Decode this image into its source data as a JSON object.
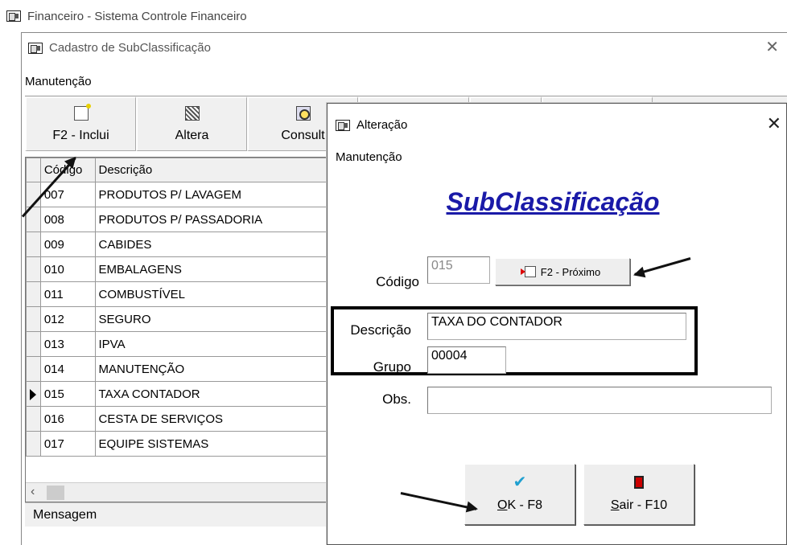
{
  "main_window": {
    "title": "Financeiro - Sistema Controle Financeiro"
  },
  "cadastro_window": {
    "title": "Cadastro de SubClassificação",
    "close_glyph": "✕",
    "menu": "Manutenção",
    "toolbar": {
      "inclui": "F2 - Inclui",
      "altera": "Altera",
      "consulta": "Consult"
    },
    "grid": {
      "headers": {
        "code": "Código",
        "desc": "Descrição"
      },
      "rows": [
        {
          "code": "007",
          "desc": "PRODUTOS P/ LAVAGEM"
        },
        {
          "code": "008",
          "desc": "PRODUTOS P/ PASSADORIA"
        },
        {
          "code": "009",
          "desc": "CABIDES"
        },
        {
          "code": "010",
          "desc": "EMBALAGENS"
        },
        {
          "code": "011",
          "desc": "COMBUSTÍVEL"
        },
        {
          "code": "012",
          "desc": "SEGURO"
        },
        {
          "code": "013",
          "desc": "IPVA"
        },
        {
          "code": "014",
          "desc": "MANUTENÇÃO"
        },
        {
          "code": "015",
          "desc": "TAXA CONTADOR"
        },
        {
          "code": "016",
          "desc": "CESTA DE SERVIÇOS"
        },
        {
          "code": "017",
          "desc": "EQUIPE SISTEMAS"
        }
      ],
      "selected_row_code": "015",
      "scroll_left_glyph": "‹"
    },
    "status": "Mensagem"
  },
  "alteracao_window": {
    "title": "Alteração",
    "close_glyph": "✕",
    "menu": "Manutenção",
    "heading": "SubClassificação",
    "fields": {
      "codigo_label": "Código",
      "codigo_value": "015",
      "proximo_button": "F2 - Próximo",
      "descricao_label": "Descrição",
      "descricao_value": "TAXA DO CONTADOR",
      "grupo_label": "Grupo",
      "grupo_value": "00004",
      "obs_label": "Obs.",
      "obs_value": ""
    },
    "buttons": {
      "ok_mnemonic": "O",
      "ok_rest": "K - F8",
      "sair_mnemonic": "S",
      "sair_rest": "air - F10"
    }
  }
}
